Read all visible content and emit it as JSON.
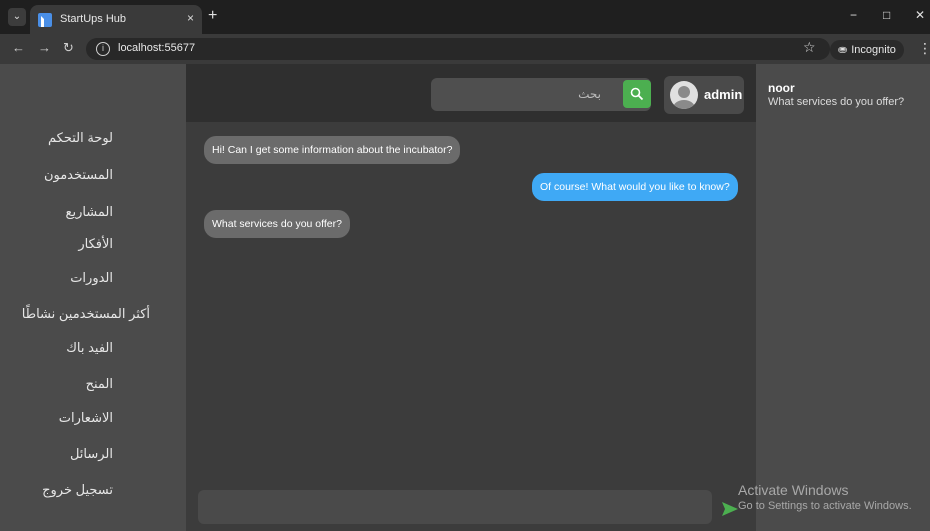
{
  "browser": {
    "tab_title": "StartUps Hub",
    "tab_close": "×",
    "new_tab": "+",
    "url": "localhost:55677",
    "incognito_label": "Incognito",
    "window_controls": {
      "minimize": "−",
      "maximize": "□",
      "close": "✕"
    }
  },
  "sidebar": {
    "items": [
      {
        "label": "لوحة التحكم"
      },
      {
        "label": "المستخدمون"
      },
      {
        "label": "المشاريع"
      },
      {
        "label": "الأفكار"
      },
      {
        "label": "الدورات"
      },
      {
        "label": "أكثر المستخدمين نشاطًا"
      },
      {
        "label": "الفيد باك"
      },
      {
        "label": "المنح"
      },
      {
        "label": "الاشعارات"
      },
      {
        "label": "الرسائل"
      },
      {
        "label": "تسجيل خروج"
      }
    ]
  },
  "topbar": {
    "search_placeholder": "بحث",
    "user_name": "admin"
  },
  "chat": {
    "messages": [
      {
        "text": "Hi! Can I get some information about the incubator?",
        "direction": "incoming"
      },
      {
        "text": "Of course! What would you like to know?",
        "direction": "outgoing"
      },
      {
        "text": "What services do you offer?",
        "direction": "incoming"
      }
    ],
    "composer_placeholder": ""
  },
  "conversation": {
    "name": "noor",
    "last_message": "What services do you offer?"
  },
  "watermark": {
    "title": "Activate Windows",
    "subtitle": "Go to Settings to activate Windows."
  },
  "colors": {
    "accent_search": "#4caf50",
    "outgoing_bubble": "#3fa9f5",
    "incoming_bubble": "#6b6b6b"
  }
}
